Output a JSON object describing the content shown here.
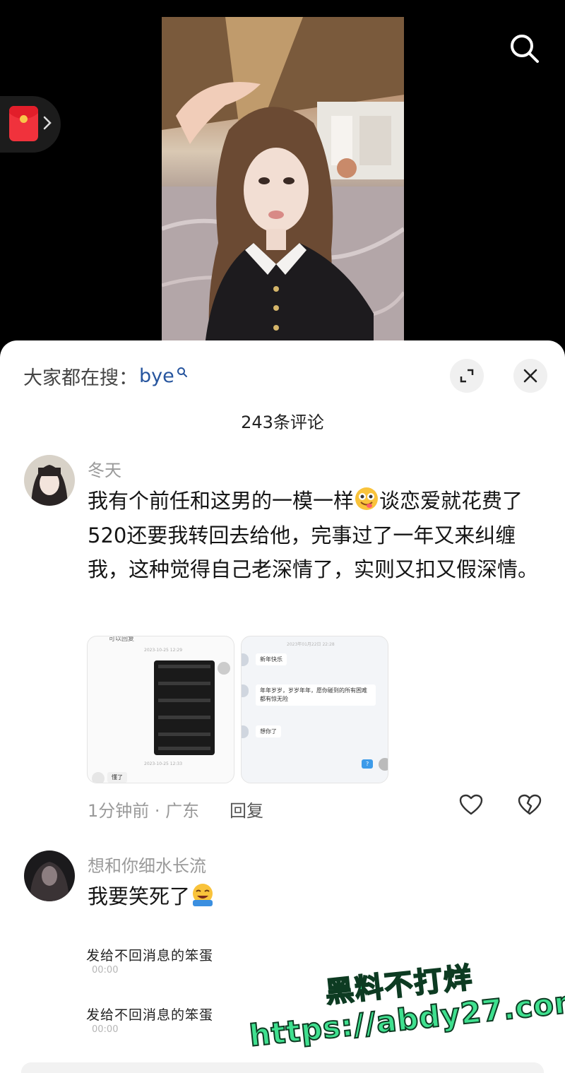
{
  "video": {
    "description_icon": "video-frame"
  },
  "icons": {
    "search": "search-icon",
    "red_packet": "red-packet-icon",
    "chevron": "chevron-right-icon",
    "expand": "expand-icon",
    "close": "close-icon",
    "like": "heart-icon",
    "dislike": "broken-heart-icon"
  },
  "comments_panel": {
    "search_hint_label": "大家都在搜：",
    "search_hint_term": "bye",
    "count_label": "243条评论"
  },
  "comments": [
    {
      "username": "冬天",
      "text_before_emoji": "我有个前任和这男的一模一样",
      "text_after_emoji": "谈恋爱就花费了520还要我转回去给他，完事过了一年又来纠缠我，这种觉得自己老深情了，实则又扣又假深情。",
      "meta": "1分钟前 · 广东",
      "reply_label": "回复",
      "attachments": [
        {
          "top_text": "可以回复",
          "timestamp": "2023-10-25 12:29",
          "bottom_timestamp": "2023-10-25 12:33",
          "reply": "懂了"
        },
        {
          "timestamp": "2023年01月22日 22:28",
          "messages": [
            "新年快乐",
            "年年岁岁，岁岁年年，愿你碰到的所有困难都有惊无险",
            "想你了"
          ],
          "sent": "?"
        }
      ]
    },
    {
      "username": "想和你细水长流",
      "text": "我要笑死了",
      "sticker": {
        "line_1": "发给不回消息的笨蛋",
        "line_1_sub": "00:00",
        "line_2": "发给不回消息的笨蛋",
        "line_2_sub": "00:00"
      }
    }
  ],
  "watermark": {
    "line_1": "黑料不打烊",
    "line_2": "https://abdy27.com"
  }
}
